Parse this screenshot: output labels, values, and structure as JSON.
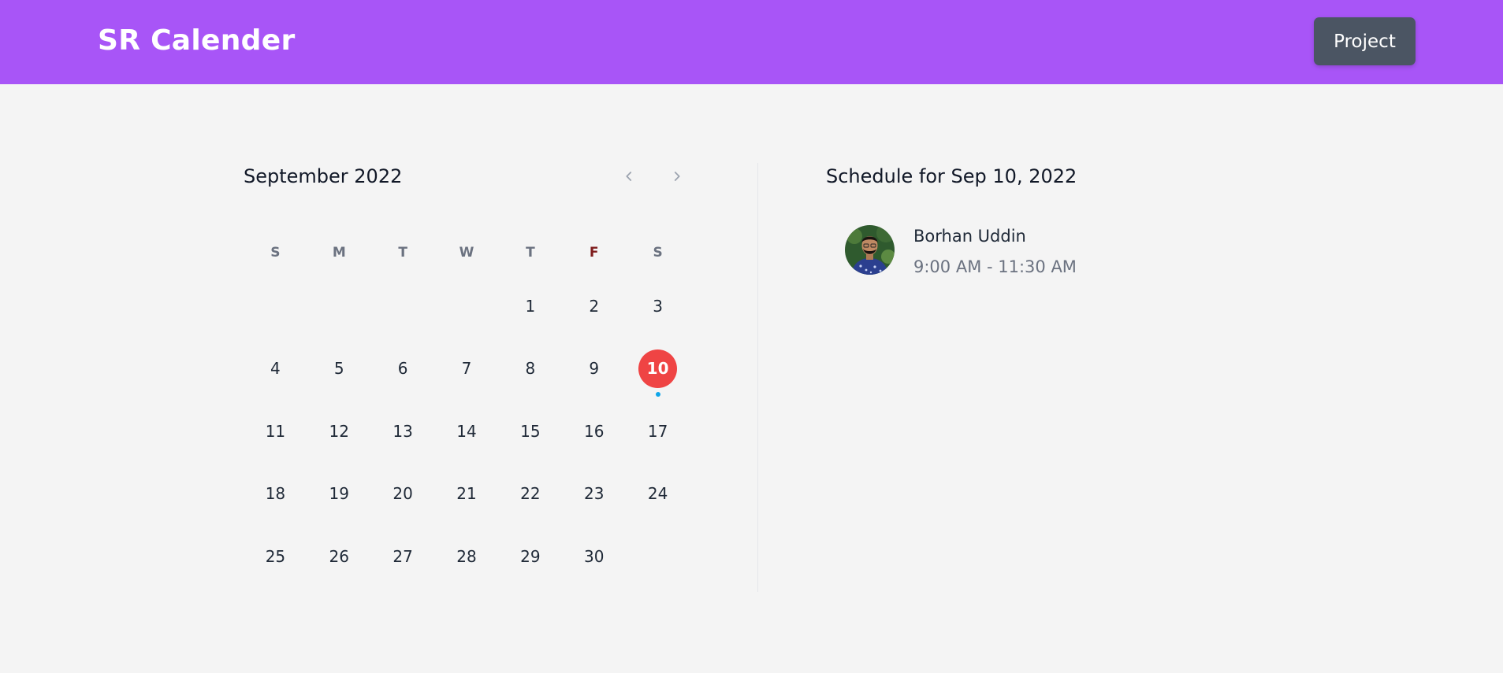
{
  "header": {
    "brand": "SR Calender",
    "project_label": "Project",
    "color": "#a855f7"
  },
  "calendar": {
    "month_title": "September 2022",
    "prev_icon": "chevron-left-icon",
    "next_icon": "chevron-right-icon",
    "weekdays": [
      "S",
      "M",
      "T",
      "W",
      "T",
      "F",
      "S"
    ],
    "first_weekday_index": 4,
    "days": [
      "1",
      "2",
      "3",
      "4",
      "5",
      "6",
      "7",
      "8",
      "9",
      "10",
      "11",
      "12",
      "13",
      "14",
      "15",
      "16",
      "17",
      "18",
      "19",
      "20",
      "21",
      "22",
      "23",
      "24",
      "25",
      "26",
      "27",
      "28",
      "29",
      "30"
    ],
    "selected_day": "10",
    "days_with_events": [
      "10"
    ],
    "selected_color": "#ef4444",
    "event_dot_color": "#0ea5e9"
  },
  "schedule": {
    "title": "Schedule for Sep 10, 2022",
    "meetings": [
      {
        "name": "Borhan Uddin",
        "time": "9:00 AM - 11:30 AM",
        "avatar": "avatar-photo"
      }
    ]
  }
}
